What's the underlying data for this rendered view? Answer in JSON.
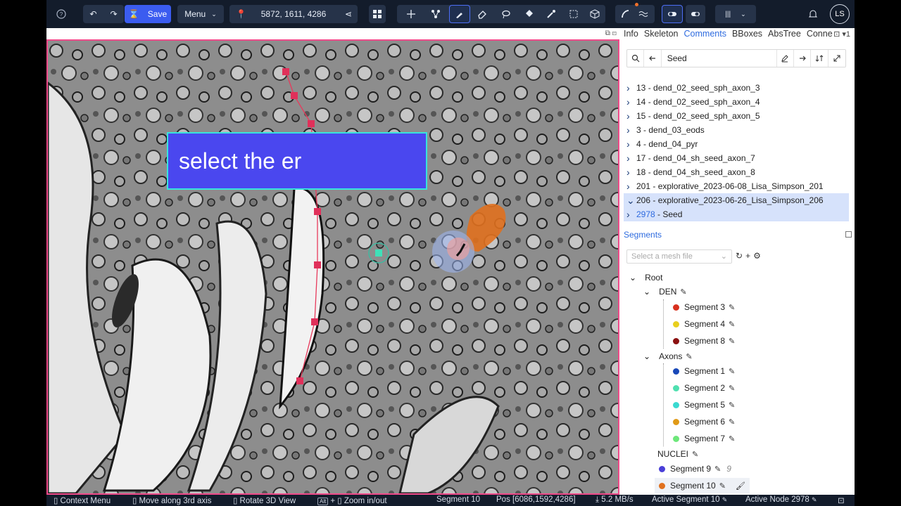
{
  "toolbar": {
    "help_icon": "?",
    "undo": "↶",
    "redo": "↷",
    "save_label": "Save",
    "menu_label": "Menu",
    "position": "5872, 1611, 4286",
    "tools": [
      "move-tool",
      "skeleton-tool",
      "brush-tool",
      "eraser-tool",
      "lasso-tool",
      "fill-tool",
      "pipette-tool",
      "bounding-box-tool",
      "proofread-tool"
    ],
    "avatar": "LS"
  },
  "overlay": {
    "text": "select the er"
  },
  "panel": {
    "tabs": [
      "Info",
      "Skeleton",
      "Comments",
      "BBoxes",
      "AbsTree",
      "Conne"
    ],
    "active_tab": "Comments",
    "tabs_right": "▾1",
    "search_value": "Seed",
    "tree_items": [
      {
        "id": "13",
        "label": "dend_02_seed_sph_axon_3",
        "expanded": false
      },
      {
        "id": "14",
        "label": "dend_02_seed_sph_axon_4",
        "expanded": false
      },
      {
        "id": "15",
        "label": "dend_02_seed_sph_axon_5",
        "expanded": false
      },
      {
        "id": "3",
        "label": "dend_03_eods",
        "expanded": false
      },
      {
        "id": "4",
        "label": "dend_04_pyr",
        "expanded": false
      },
      {
        "id": "17",
        "label": "dend_04_sh_seed_axon_7",
        "expanded": false
      },
      {
        "id": "18",
        "label": "dend_04_sh_seed_axon_8",
        "expanded": false
      },
      {
        "id": "201",
        "label": "explorative_2023-06-08_Lisa_Simpson_201",
        "expanded": false
      },
      {
        "id": "206",
        "label": "explorative_2023-06-26_Lisa_Simpson_206",
        "expanded": true
      },
      {
        "id": "2978",
        "label": "Seed",
        "expanded": false
      }
    ],
    "segments_title": "Segments",
    "mesh_placeholder": "Select a mesh file",
    "segments": {
      "root": "Root",
      "den": "DEN",
      "axons": "Axons",
      "nuclei": "NUCLEI",
      "den_items": [
        {
          "name": "Segment 3",
          "color": "#d8311f"
        },
        {
          "name": "Segment 4",
          "color": "#e8cf1e"
        },
        {
          "name": "Segment 8",
          "color": "#8b1010"
        }
      ],
      "axon_items": [
        {
          "name": "Segment 1",
          "color": "#1848b8"
        },
        {
          "name": "Segment 2",
          "color": "#4fe0b0"
        },
        {
          "name": "Segment 5",
          "color": "#3ad9d0"
        },
        {
          "name": "Segment 6",
          "color": "#e09a18"
        },
        {
          "name": "Segment 7",
          "color": "#6de77a"
        }
      ],
      "extra_items": [
        {
          "name": "Segment 9",
          "color": "#4a3fd8",
          "count": "9"
        },
        {
          "name": "Segment 10",
          "color": "#e0701e"
        }
      ]
    }
  },
  "status": {
    "context_menu": "Context Menu",
    "move_axis": "Move along 3rd axis",
    "rotate": "Rotate 3D View",
    "alt_key": "Alt",
    "zoom": "Zoom in/out",
    "segment": "Segment 10",
    "pos": "Pos [6086,1592,4286]",
    "speed": "5.2 MB/s",
    "active_segment": "Active Segment 10",
    "active_node": "Active Node 2978"
  },
  "colors": {
    "accent": "#3b5cf0",
    "toolbar_bg": "#131c2b",
    "viewport_border": "#f04a8a",
    "overlay_bg": "#4a47ef"
  }
}
